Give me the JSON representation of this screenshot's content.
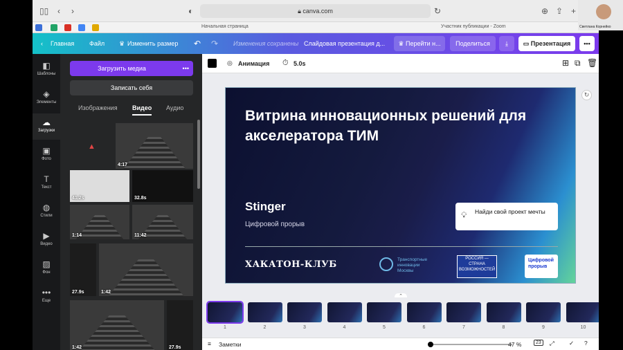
{
  "browser": {
    "url": "canva.com",
    "tabs": [
      "Начальная страница",
      "Участник публикации - Zoom"
    ]
  },
  "zoom_cam": {
    "label": "Светлана Корнейко"
  },
  "topbar": {
    "home": "Главная",
    "file": "Файл",
    "resize": "Изменить размер",
    "saved": "Изменения сохранены",
    "doc_title": "Слайдовая презентация д...",
    "go_pro": "Перейти н...",
    "share": "Поделиться",
    "present": "Презентация"
  },
  "rail": [
    {
      "label": "Шаблоны",
      "icon": "templates-icon",
      "glyph": "◧"
    },
    {
      "label": "Элементы",
      "icon": "elements-icon",
      "glyph": "◈"
    },
    {
      "label": "Загрузки",
      "icon": "uploads-icon",
      "glyph": "☁"
    },
    {
      "label": "Фото",
      "icon": "photo-icon",
      "glyph": "▣"
    },
    {
      "label": "Текст",
      "icon": "text-icon",
      "glyph": "T"
    },
    {
      "label": "Стили",
      "icon": "styles-icon",
      "glyph": "◍"
    },
    {
      "label": "Видео",
      "icon": "video-icon",
      "glyph": "▶"
    },
    {
      "label": "Фон",
      "icon": "background-icon",
      "glyph": "▨"
    },
    {
      "label": "Еще",
      "icon": "more-icon",
      "glyph": "•••"
    }
  ],
  "panel": {
    "upload": "Загрузить медиа",
    "record": "Записать себя",
    "tabs": [
      "Изображения",
      "Видео",
      "Аудио"
    ],
    "durations": [
      "4:17",
      "41.2s",
      "32.8s",
      "1:14",
      "11:42",
      "27.9s",
      "1:42",
      "1:42",
      "27.9s"
    ]
  },
  "context": {
    "animation": "Анимация",
    "duration": "5.0s"
  },
  "slide": {
    "title": "Витрина инновационных решений для акселератора ТИМ",
    "name": "Stinger",
    "subtitle": "Цифровой прорыв",
    "card": "Найди свой проект мечты",
    "logo_hack": "ХАКАТОН-КЛУБ",
    "logo_ti": "Транспортные инновации Москвы",
    "logo_russia": "РОССИЯ — СТРАНА ВОЗМОЖНОСТЕЙ",
    "logo_cp": "Цифровой прорыв"
  },
  "filmstrip": [
    "1",
    "2",
    "3",
    "4",
    "5",
    "6",
    "7",
    "8",
    "9",
    "10"
  ],
  "bottom": {
    "notes": "Заметки",
    "zoom": "47 %",
    "pages": "23"
  },
  "colors": {
    "accent": "#7c3aed",
    "teal": "#14c1c8"
  }
}
